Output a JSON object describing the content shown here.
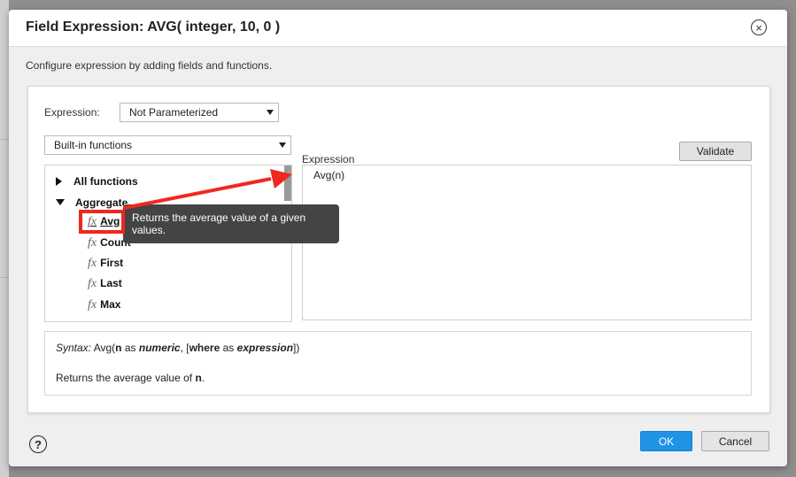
{
  "dialog": {
    "title": "Field Expression: AVG( integer, 10, 0 )",
    "subtitle": "Configure expression by adding fields and functions."
  },
  "expression_select": {
    "label": "Expression:",
    "value": "Not Parameterized"
  },
  "functions_select": {
    "value": "Built-in functions"
  },
  "tree": {
    "all_functions": "All functions",
    "aggregate": "Aggregate",
    "items": [
      "Avg",
      "Count",
      "First",
      "Last",
      "Max"
    ],
    "fx_symbol": "fx"
  },
  "expression_panel": {
    "label": "Expression",
    "validate_label": "Validate",
    "content": "Avg(n)"
  },
  "syntax": {
    "prefix": "Syntax:",
    "fn": "Avg(",
    "arg1": "n",
    "as1": "as",
    "type1": "numeric",
    "sep": ", [",
    "kw_where": "where",
    "as2": "as",
    "type2": "expression",
    "close": "])",
    "desc_prefix": "Returns the average value of",
    "desc_arg": "n",
    "desc_suffix": "."
  },
  "tooltip": {
    "text": "Returns the average value of a given values."
  },
  "footer": {
    "help_symbol": "?",
    "ok_label": "OK",
    "cancel_label": "Cancel"
  },
  "colors": {
    "accent_blue": "#1f93e6",
    "annotation_red": "#f0281e",
    "tooltip_bg": "#444444"
  }
}
